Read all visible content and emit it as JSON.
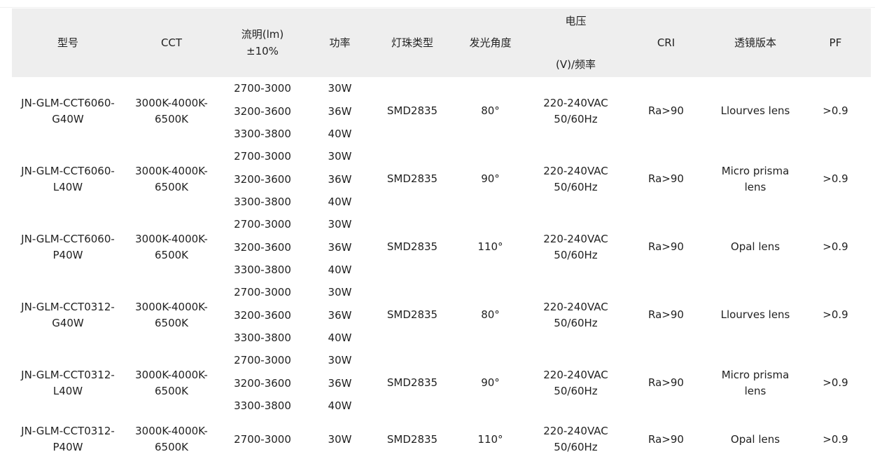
{
  "header": {
    "model": "型号",
    "cct": "CCT",
    "flux_line1": "流明(lm)",
    "flux_line2": "±10%",
    "power": "功率",
    "led_type": "灯珠类型",
    "beam_angle": "发光角度",
    "voltage_line1": "电压",
    "voltage_line2": "(V)/频率",
    "cri": "CRI",
    "lens": "透镜版本",
    "pf": "PF"
  },
  "groups": [
    {
      "model_line1": "JN-GLM-CCT6060-",
      "model_line2": "G40W",
      "cct_line1": "3000K-4000K-",
      "cct_line2": "6500K",
      "rows": [
        {
          "lumen": "2700-3000",
          "power": "30W"
        },
        {
          "lumen": "3200-3600",
          "power": "36W"
        },
        {
          "lumen": "3300-3800",
          "power": "40W"
        }
      ],
      "led": "SMD2835",
      "angle": "80°",
      "voltage_line1": "220-240VAC",
      "voltage_line2": "50/60Hz",
      "cri": "Ra>90",
      "lens_line1": "Llourves lens",
      "lens_line2": "",
      "pf": ">0.9"
    },
    {
      "model_line1": "JN-GLM-CCT6060-",
      "model_line2": "L40W",
      "cct_line1": "3000K-4000K-",
      "cct_line2": "6500K",
      "rows": [
        {
          "lumen": "2700-3000",
          "power": "30W"
        },
        {
          "lumen": "3200-3600",
          "power": "36W"
        },
        {
          "lumen": "3300-3800",
          "power": "40W"
        }
      ],
      "led": "SMD2835",
      "angle": "90°",
      "voltage_line1": "220-240VAC",
      "voltage_line2": "50/60Hz",
      "cri": "Ra>90",
      "lens_line1": "Micro prisma",
      "lens_line2": "lens",
      "pf": ">0.9"
    },
    {
      "model_line1": "JN-GLM-CCT6060-",
      "model_line2": "P40W",
      "cct_line1": "3000K-4000K-",
      "cct_line2": "6500K",
      "rows": [
        {
          "lumen": "2700-3000",
          "power": "30W"
        },
        {
          "lumen": "3200-3600",
          "power": "36W"
        },
        {
          "lumen": "3300-3800",
          "power": "40W"
        }
      ],
      "led": "SMD2835",
      "angle": "110°",
      "voltage_line1": "220-240VAC",
      "voltage_line2": "50/60Hz",
      "cri": "Ra>90",
      "lens_line1": "Opal lens",
      "lens_line2": "",
      "pf": ">0.9"
    },
    {
      "model_line1": "JN-GLM-CCT0312-",
      "model_line2": "G40W",
      "cct_line1": "3000K-4000K-",
      "cct_line2": "6500K",
      "rows": [
        {
          "lumen": "2700-3000",
          "power": "30W"
        },
        {
          "lumen": "3200-3600",
          "power": "36W"
        },
        {
          "lumen": "3300-3800",
          "power": "40W"
        }
      ],
      "led": "SMD2835",
      "angle": "80°",
      "voltage_line1": "220-240VAC",
      "voltage_line2": "50/60Hz",
      "cri": "Ra>90",
      "lens_line1": "Llourves lens",
      "lens_line2": "",
      "pf": ">0.9"
    },
    {
      "model_line1": "JN-GLM-CCT0312-",
      "model_line2": "L40W",
      "cct_line1": "3000K-4000K-",
      "cct_line2": "6500K",
      "rows": [
        {
          "lumen": "2700-3000",
          "power": "30W"
        },
        {
          "lumen": "3200-3600",
          "power": "36W"
        },
        {
          "lumen": "3300-3800",
          "power": "40W"
        }
      ],
      "led": "SMD2835",
      "angle": "90°",
      "voltage_line1": "220-240VAC",
      "voltage_line2": "50/60Hz",
      "cri": "Ra>90",
      "lens_line1": "Micro prisma",
      "lens_line2": "lens",
      "pf": ">0.9"
    },
    {
      "model_line1": "JN-GLM-CCT0312-",
      "model_line2": "P40W",
      "cct_line1": "3000K-4000K-",
      "cct_line2": "6500K",
      "rows": [
        {
          "lumen": "2700-3000",
          "power": "30W"
        }
      ],
      "led": "SMD2835",
      "angle": "110°",
      "voltage_line1": "220-240VAC",
      "voltage_line2": "50/60Hz",
      "cri": "Ra>90",
      "lens_line1": "Opal lens",
      "lens_line2": "",
      "pf": ">0.9"
    }
  ]
}
